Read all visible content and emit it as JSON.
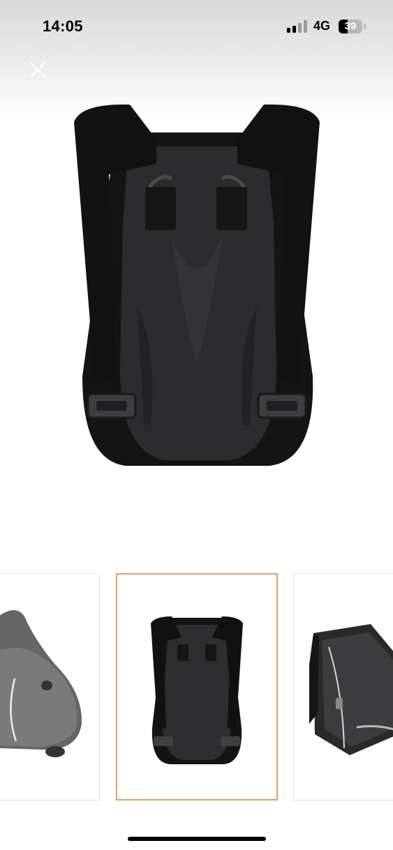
{
  "status_bar": {
    "time": "14:05",
    "network": "4G",
    "battery_percent": "39",
    "battery_level": 0.39,
    "signal_bars_active": 2,
    "signal_bars_total": 4
  },
  "viewer": {
    "close_icon": "close-icon",
    "main_image": "black-backpack-back-view",
    "thumbnails": [
      {
        "image": "grey-mesh-carrier-side-view",
        "selected": false
      },
      {
        "image": "black-backpack-back-view",
        "selected": true
      },
      {
        "image": "black-backpack-open-view",
        "selected": false
      }
    ],
    "selected_border_color": "#e0a060"
  }
}
